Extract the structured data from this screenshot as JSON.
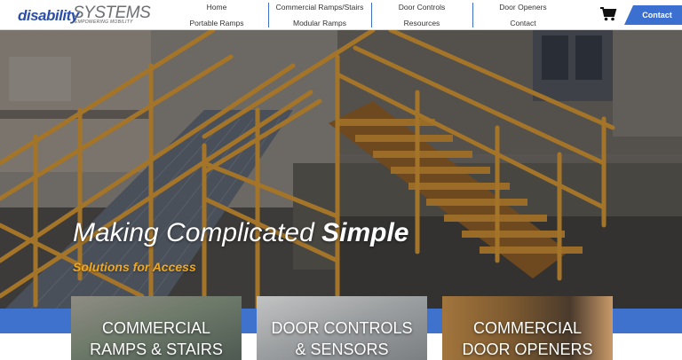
{
  "logo": {
    "brand_a": "disability",
    "brand_b": "SYSTEMS",
    "tagline": "EMPOWERING MOBILITY"
  },
  "nav": {
    "col1": [
      "Home",
      "Portable Ramps"
    ],
    "col2": [
      "Commercial Ramps/Stairs",
      "Modular Ramps"
    ],
    "col3": [
      "Door Controls",
      "Resources"
    ],
    "col4": [
      "Door Openers",
      "Contact"
    ]
  },
  "header": {
    "contact_label": "Contact",
    "cart_icon": "shopping-cart-icon"
  },
  "hero": {
    "title_regular": "Making Complicated ",
    "title_bold": "Simple",
    "subtitle": "Solutions for Access"
  },
  "cards": [
    {
      "line1": "COMMERCIAL",
      "line2": "RAMPS & STAIRS"
    },
    {
      "line1": "DOOR CONTROLS",
      "line2": "& SENSORS"
    },
    {
      "line1": "COMMERCIAL",
      "line2": "DOOR OPENERS"
    }
  ],
  "colors": {
    "accent_blue": "#3b6fd0",
    "hero_orange": "#f0a81e",
    "railing_orange": "#c98a2e"
  }
}
